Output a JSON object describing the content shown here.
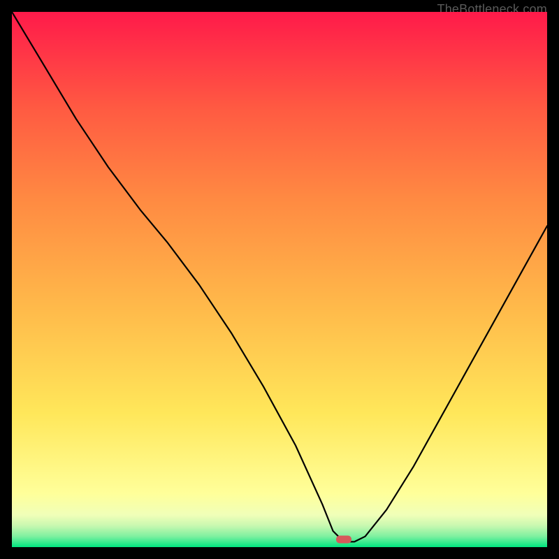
{
  "watermark": "TheBottleneck.com",
  "colors": {
    "gradient_top": "#ff1a4a",
    "gradient_mid_upper": "#ff6a3a",
    "gradient_mid": "#ffd23a",
    "gradient_lower": "#ffff9a",
    "gradient_near_bottom": "#d8ffba",
    "gradient_bottom": "#00e57f",
    "curve": "#000000",
    "marker": "#d65a5a",
    "frame": "#000000"
  },
  "chart_data": {
    "type": "line",
    "title": "",
    "xlabel": "",
    "ylabel": "",
    "xlim": [
      0,
      100
    ],
    "ylim": [
      0,
      100
    ],
    "series": [
      {
        "name": "bottleneck-curve",
        "x": [
          0,
          6,
          12,
          18,
          24,
          29,
          35,
          41,
          47,
          53,
          58,
          60,
          62,
          64,
          66,
          70,
          75,
          80,
          85,
          90,
          95,
          100
        ],
        "y": [
          100,
          90,
          80,
          71,
          63,
          57,
          49,
          40,
          30,
          19,
          8,
          3,
          1,
          1,
          2,
          7,
          15,
          24,
          33,
          42,
          51,
          60
        ]
      }
    ],
    "annotations": [
      {
        "name": "optimal-marker",
        "x": 62,
        "y": 1.5
      }
    ],
    "gradient_bands_y": [
      {
        "y": 0,
        "color": "#00e57f"
      },
      {
        "y": 2,
        "color": "#7ef0a0"
      },
      {
        "y": 4,
        "color": "#c8f8b0"
      },
      {
        "y": 6,
        "color": "#f0ffb8"
      },
      {
        "y": 10,
        "color": "#ffff9a"
      },
      {
        "y": 25,
        "color": "#ffe75a"
      },
      {
        "y": 45,
        "color": "#ffb94a"
      },
      {
        "y": 65,
        "color": "#ff8a42"
      },
      {
        "y": 82,
        "color": "#ff5a42"
      },
      {
        "y": 100,
        "color": "#ff1a4a"
      }
    ]
  }
}
